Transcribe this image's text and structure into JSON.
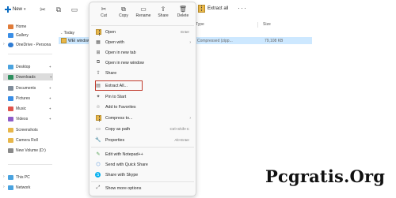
{
  "toolbar": {
    "new_label": "New",
    "extract_all_label": "Extract all",
    "more_label": "···"
  },
  "sidebar": {
    "items": [
      {
        "label": "Home",
        "icon": "home-icon",
        "color": "#e07b39"
      },
      {
        "label": "Gallery",
        "icon": "gallery-icon",
        "color": "#3a8ee6"
      },
      {
        "label": "OneDrive - Persona",
        "icon": "onedrive-icon",
        "color": "#2f7cd3"
      },
      {
        "label": "Desktop",
        "icon": "desktop-icon",
        "color": "#4aa3df"
      },
      {
        "label": "Downloads",
        "icon": "downloads-icon",
        "color": "#2d8f5e"
      },
      {
        "label": "Documents",
        "icon": "documents-icon",
        "color": "#7f8c9a"
      },
      {
        "label": "Pictures",
        "icon": "pictures-icon",
        "color": "#3a8ee6"
      },
      {
        "label": "Music",
        "icon": "music-icon",
        "color": "#e0544c"
      },
      {
        "label": "Videos",
        "icon": "videos-icon",
        "color": "#8e5cc8"
      },
      {
        "label": "Screenshots",
        "icon": "folder-icon",
        "color": "#e8b74a"
      },
      {
        "label": "Camera Roll",
        "icon": "folder-icon",
        "color": "#e8b74a"
      },
      {
        "label": "New Volume (D:)",
        "icon": "drive-icon",
        "color": "#8a8a8a"
      },
      {
        "label": "This PC",
        "icon": "pc-icon",
        "color": "#4aa3df"
      },
      {
        "label": "Network",
        "icon": "network-icon",
        "color": "#4aa3df"
      }
    ]
  },
  "content": {
    "group_label": "Today",
    "columns": [
      "Type",
      "Size"
    ],
    "file": {
      "name": "WEI windows",
      "type": "Compressed (zipp...",
      "size": "79,108 KB"
    }
  },
  "context_menu": {
    "quick_actions": [
      {
        "label": "Cut",
        "icon": "cut-icon"
      },
      {
        "label": "Copy",
        "icon": "copy-icon"
      },
      {
        "label": "Rename",
        "icon": "rename-icon"
      },
      {
        "label": "Share",
        "icon": "share-icon"
      },
      {
        "label": "Delete",
        "icon": "delete-icon"
      }
    ],
    "items": [
      {
        "label": "Open",
        "icon": "zip-icon",
        "shortcut": "Enter"
      },
      {
        "label": "Open with",
        "icon": "open-with-icon",
        "arrow": true
      },
      {
        "label": "Open in new tab",
        "icon": "new-tab-icon"
      },
      {
        "label": "Open in new window",
        "icon": "new-window-icon"
      },
      {
        "label": "Share",
        "icon": "share-icon"
      },
      {
        "label": "Extract All...",
        "icon": "extract-icon",
        "highlighted": true
      },
      {
        "label": "Pin to Start",
        "icon": "pin-icon"
      },
      {
        "label": "Add to Favorites",
        "icon": "star-icon"
      },
      {
        "label": "Compress to...",
        "icon": "compress-icon",
        "arrow": true
      },
      {
        "label": "Copy as path",
        "icon": "copy-path-icon",
        "shortcut": "Ctrl+Shift+C"
      },
      {
        "label": "Properties",
        "icon": "properties-icon",
        "shortcut": "Alt+Enter"
      },
      {
        "label": "Edit with Notepad++",
        "icon": "notepad-icon"
      },
      {
        "label": "Send with Quick Share",
        "icon": "quick-share-icon"
      },
      {
        "label": "Share with Skype",
        "icon": "skype-icon"
      },
      {
        "label": "Show more options",
        "icon": "more-options-icon"
      }
    ],
    "highlight_color": "#c0392b"
  },
  "watermark": "Pcgratis.Org"
}
